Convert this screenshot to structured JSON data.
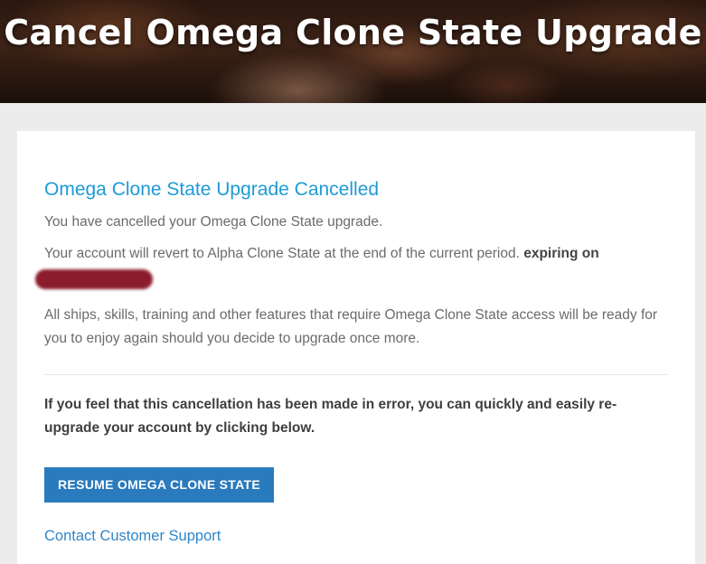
{
  "page": {
    "title": "Cancel Omega Clone State Upgrade"
  },
  "card": {
    "heading": "Omega Clone State Upgrade Cancelled",
    "line1": "You have cancelled your Omega Clone State upgrade.",
    "line2": "Your account will revert to Alpha Clone State at the end of the current period.",
    "line2_bold": "expiring on",
    "line3": "All ships, skills, training and other features that require Omega Clone State access will be ready for you to enjoy again should you decide to upgrade once more.",
    "line4": "If you feel that this cancellation has been made in error, you can quickly and easily re-upgrade your account by clicking below.",
    "resume_button": "RESUME OMEGA CLONE STATE",
    "support_link": "Contact Customer Support"
  },
  "colors": {
    "heading": "#1e9ad6",
    "button": "#2a7bbd",
    "redaction": "#8b1c2b",
    "background": "#ececec"
  }
}
